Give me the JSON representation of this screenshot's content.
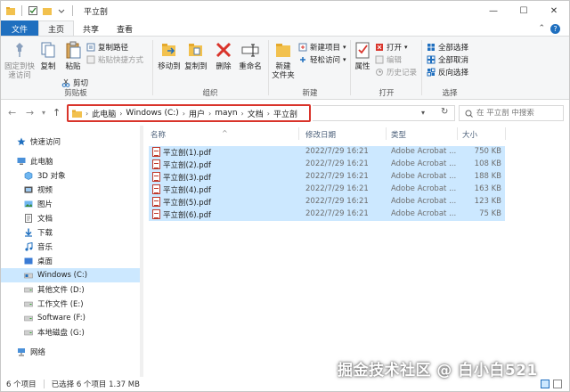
{
  "window": {
    "title": "平立剖"
  },
  "colors": {
    "accent": "#1f6fbf",
    "selection": "#cce8ff",
    "highlight_border": "#d9342b"
  },
  "tabs": [
    {
      "label": "文件"
    },
    {
      "label": "主页"
    },
    {
      "label": "共享"
    },
    {
      "label": "查看"
    }
  ],
  "ribbon": {
    "clipboard": {
      "label": "剪贴板",
      "pin": "固定到快\n速访问",
      "copy": "复制",
      "paste": "粘贴",
      "copy_path": "复制路径",
      "paste_shortcut": "粘贴快捷方式",
      "cut": "剪切"
    },
    "organize": {
      "label": "组织",
      "move_to": "移动到",
      "copy_to": "复制到",
      "delete": "删除",
      "rename": "重命名"
    },
    "new": {
      "label": "新建",
      "new_folder": "新建\n文件夹",
      "new_item": "新建项目",
      "easy_access": "轻松访问"
    },
    "open": {
      "label": "打开",
      "properties": "属性",
      "open": "打开",
      "edit": "编辑",
      "history": "历史记录"
    },
    "select": {
      "label": "选择",
      "select_all": "全部选择",
      "select_none": "全部取消",
      "invert": "反向选择"
    }
  },
  "address": {
    "crumbs": [
      "此电脑",
      "Windows (C:)",
      "用户",
      "mayn",
      "文档",
      "平立剖"
    ],
    "search_placeholder": "在 平立剖 中搜索"
  },
  "nav": {
    "quick_access": "快速访问",
    "this_pc": "此电脑",
    "items": [
      {
        "label": "3D 对象",
        "icon": "3d-objects-icon"
      },
      {
        "label": "视频",
        "icon": "video-icon"
      },
      {
        "label": "图片",
        "icon": "pictures-icon"
      },
      {
        "label": "文档",
        "icon": "documents-icon"
      },
      {
        "label": "下载",
        "icon": "downloads-icon"
      },
      {
        "label": "音乐",
        "icon": "music-icon"
      },
      {
        "label": "桌面",
        "icon": "desktop-icon"
      },
      {
        "label": "Windows (C:)",
        "icon": "drive-icon"
      },
      {
        "label": "其他文件 (D:)",
        "icon": "drive-icon"
      },
      {
        "label": "工作文件 (E:)",
        "icon": "drive-icon"
      },
      {
        "label": "Software (F:)",
        "icon": "drive-icon"
      },
      {
        "label": "本地磁盘 (G:)",
        "icon": "drive-icon"
      }
    ],
    "network": "网络"
  },
  "columns": {
    "name": "名称",
    "date": "修改日期",
    "type": "类型",
    "size": "大小"
  },
  "files": [
    {
      "name": "平立剖(1).pdf",
      "date": "2022/7/29 16:21",
      "type": "Adobe Acrobat ...",
      "size": "750 KB"
    },
    {
      "name": "平立剖(2).pdf",
      "date": "2022/7/29 16:21",
      "type": "Adobe Acrobat ...",
      "size": "108 KB"
    },
    {
      "name": "平立剖(3).pdf",
      "date": "2022/7/29 16:21",
      "type": "Adobe Acrobat ...",
      "size": "188 KB"
    },
    {
      "name": "平立剖(4).pdf",
      "date": "2022/7/29 16:21",
      "type": "Adobe Acrobat ...",
      "size": "163 KB"
    },
    {
      "name": "平立剖(5).pdf",
      "date": "2022/7/29 16:21",
      "type": "Adobe Acrobat ...",
      "size": "123 KB"
    },
    {
      "name": "平立剖(6).pdf",
      "date": "2022/7/29 16:21",
      "type": "Adobe Acrobat ...",
      "size": "75 KB"
    }
  ],
  "status": {
    "count": "6 个项目",
    "selected": "已选择 6 个项目 1.37 MB"
  },
  "watermark": "掘金技术社区 @ 白小白521"
}
